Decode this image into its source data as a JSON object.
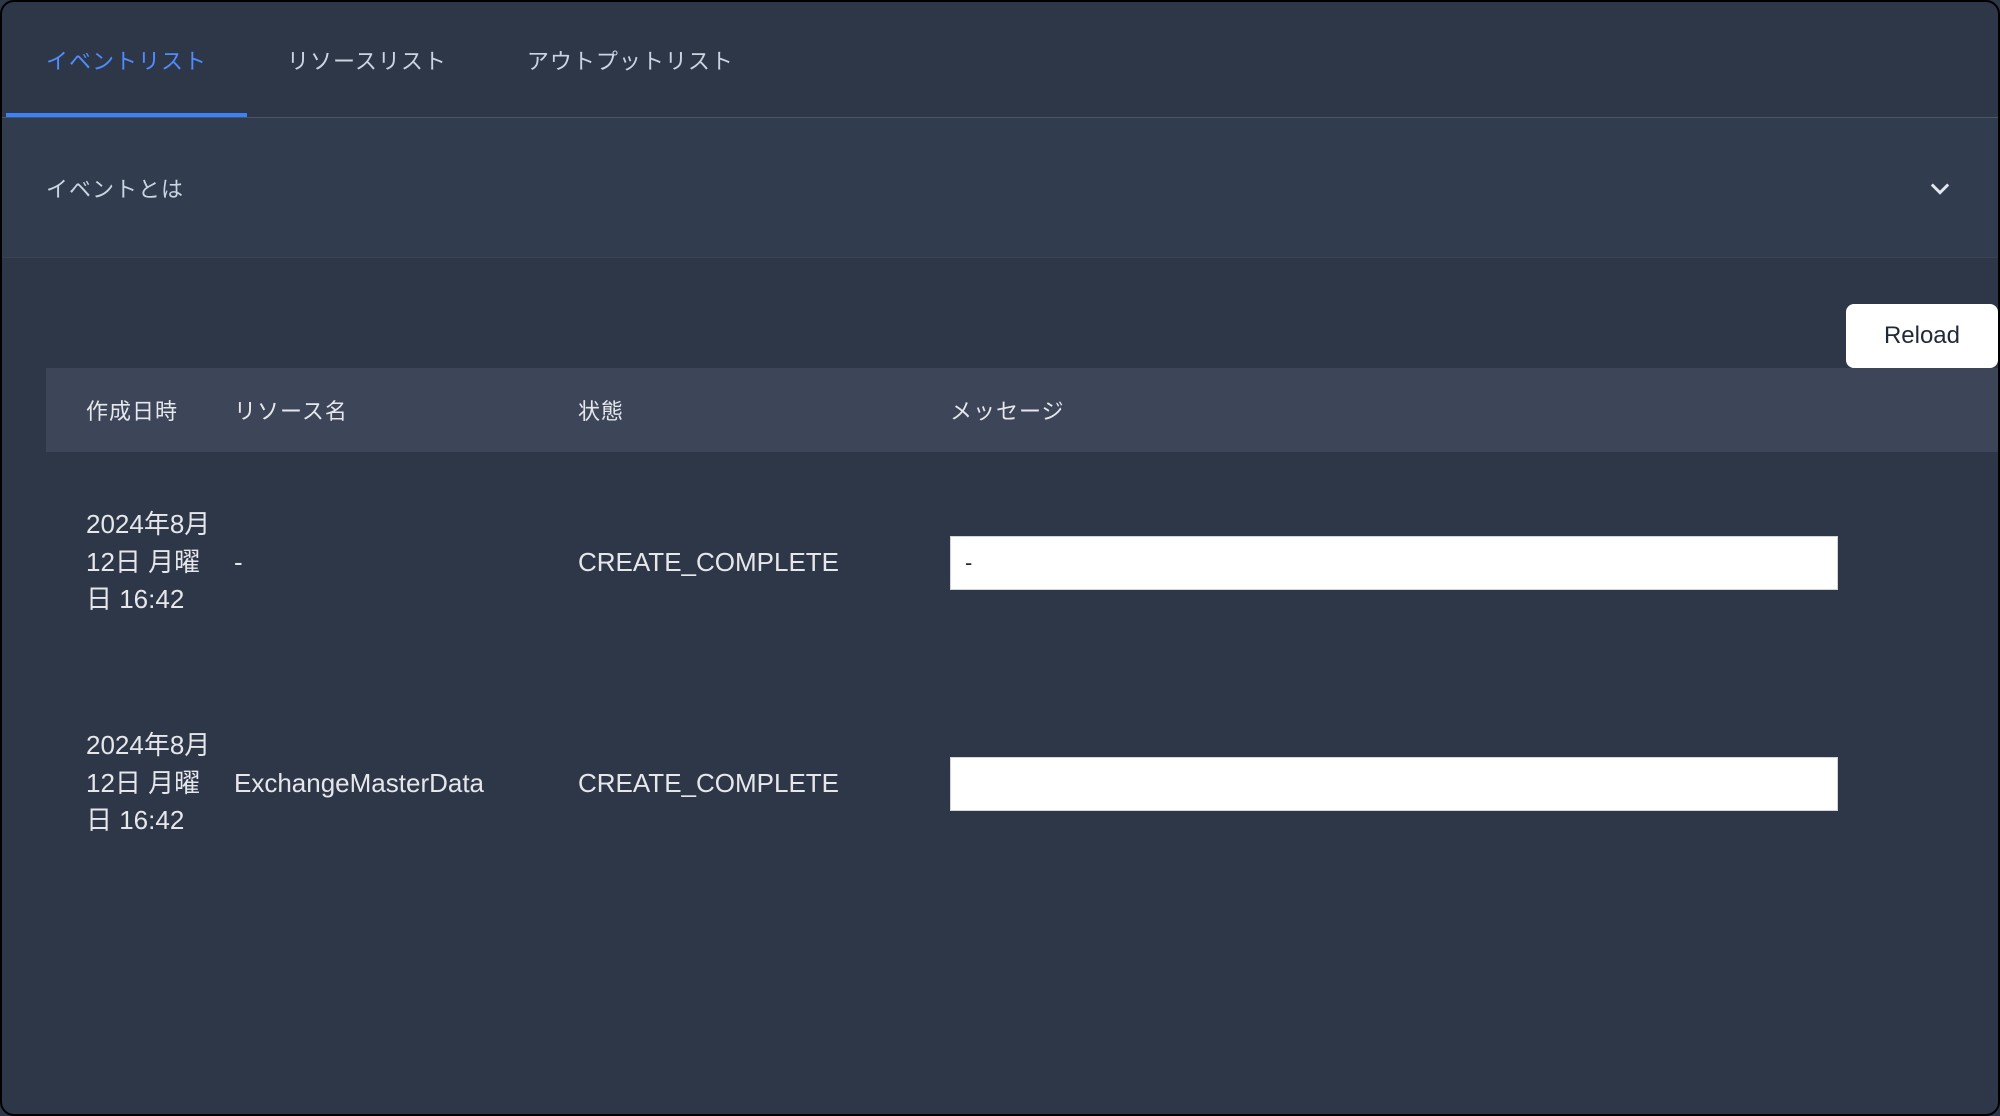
{
  "tabs": {
    "event_list": "イベントリスト",
    "resource_list": "リソースリスト",
    "output_list": "アウトプットリスト"
  },
  "accordion": {
    "title": "イベントとは"
  },
  "toolbar": {
    "reload_label": "Reload"
  },
  "table": {
    "headers": {
      "created_at": "作成日時",
      "resource_name": "リソース名",
      "status": "状態",
      "message": "メッセージ"
    },
    "rows": [
      {
        "created_at": "2024年8月12日 月曜日 16:42",
        "resource_name": "-",
        "status": "CREATE_COMPLETE",
        "message": "-"
      },
      {
        "created_at": "2024年8月12日 月曜日 16:42",
        "resource_name": "ExchangeMasterData",
        "status": "CREATE_COMPLETE",
        "message": ""
      }
    ]
  }
}
